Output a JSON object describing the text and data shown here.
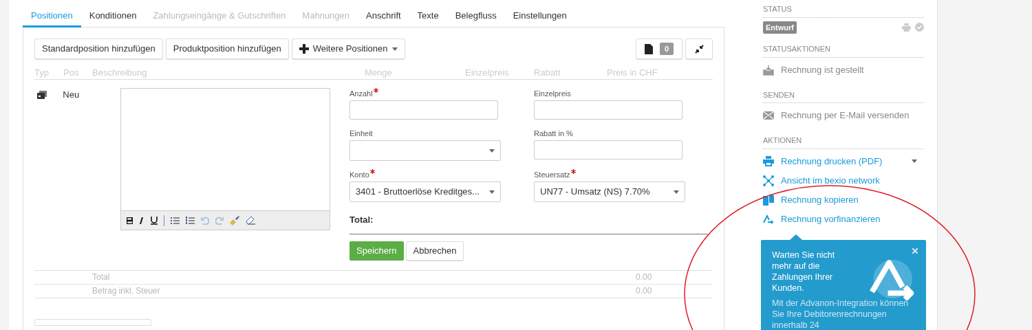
{
  "tabs": [
    {
      "label": "Positionen",
      "selected": true,
      "disabled": false
    },
    {
      "label": "Konditionen",
      "selected": false,
      "disabled": false
    },
    {
      "label": "Zahlungseingänge & Gutschriften",
      "selected": false,
      "disabled": true
    },
    {
      "label": "Mahnungen",
      "selected": false,
      "disabled": true
    },
    {
      "label": "Anschrift",
      "selected": false,
      "disabled": false
    },
    {
      "label": "Texte",
      "selected": false,
      "disabled": false
    },
    {
      "label": "Belegfluss",
      "selected": false,
      "disabled": false
    },
    {
      "label": "Einstellungen",
      "selected": false,
      "disabled": false
    }
  ],
  "toolbar": {
    "buttons": [
      "Standardposition hinzufügen",
      "Produktposition hinzufügen"
    ],
    "more_button": "Weitere Positionen",
    "document_count": "0"
  },
  "table": {
    "columns": [
      "Typ",
      "Pos",
      "Beschreibung",
      "Menge",
      "Einzelpreis",
      "Rabatt",
      "Preis in CHF"
    ],
    "row": {
      "pos": "Neu"
    },
    "fields": [
      {
        "label": "Anzahl",
        "required": true,
        "kind": "input"
      },
      {
        "label": "Einzelpreis",
        "required": false,
        "kind": "input"
      },
      {
        "label": "Einheit",
        "required": false,
        "kind": "select"
      },
      {
        "label": "Rabatt in %",
        "required": false,
        "kind": "input"
      },
      {
        "label": "Konto",
        "required": true,
        "kind": "select",
        "value": "3401 - Bruttoerlöse Kreditges..."
      },
      {
        "label": "Steuersatz",
        "required": true,
        "kind": "select",
        "value": "UN77 - Umsatz (NS) 7.70%"
      }
    ],
    "total_label": "Total:",
    "save_button": "Speichern",
    "cancel_button": "Abbrechen",
    "summary": [
      {
        "label": "Total",
        "value": "0.00"
      },
      {
        "label": "Betrag inkl. Steuer",
        "value": "0.00"
      }
    ]
  },
  "sidebar": {
    "status_heading": "STATUS",
    "status_badge": "Entwurf",
    "sections": [
      {
        "heading": "STATUSAKTIONEN",
        "items": [
          {
            "label": "Rechnung ist gestellt",
            "kind": "inbox",
            "link": false
          }
        ]
      },
      {
        "heading": "SENDEN",
        "items": [
          {
            "label": "Rechnung per E-Mail versenden",
            "kind": "mail",
            "link": false
          }
        ]
      },
      {
        "heading": "AKTIONEN",
        "items": [
          {
            "label": "Rechnung drucken (PDF)",
            "kind": "print",
            "link": true,
            "dropdown": true
          },
          {
            "label": "Ansicht im bexio network",
            "kind": "network",
            "link": true
          },
          {
            "label": "Rechnung kopieren",
            "kind": "copy",
            "link": true
          },
          {
            "label": "Rechnung vorfinanzieren",
            "kind": "finance",
            "link": true
          }
        ]
      }
    ],
    "popover": {
      "title": "Warten Sie nicht mehr auf die Zahlungen Ihrer Kunden.",
      "body": "Mit der Advanon-Integration können Sie Ihre Debitorenrechnungen innerhalb 24"
    }
  }
}
